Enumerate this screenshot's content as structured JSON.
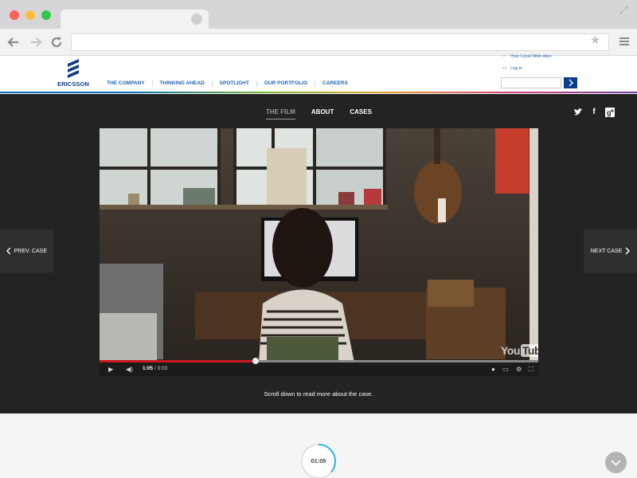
{
  "browser": {
    "address": "",
    "traffic_colors": {
      "close": "#fc605c",
      "minimize": "#fdbc40",
      "zoom": "#34c84a"
    }
  },
  "header": {
    "logo_text": "ERICSSON",
    "brand_color": "#0f3b8c",
    "nav": [
      "THE COMPANY",
      "THINKING AHEAD",
      "SPOTLIGHT",
      "OUR PORTFOLIO",
      "CAREERS"
    ],
    "local_sites_label": "Your Local Web sites",
    "login_label": "Log in",
    "search_placeholder": ""
  },
  "film": {
    "tabs": [
      {
        "label": "THE FILM",
        "active": true
      },
      {
        "label": "ABOUT",
        "active": false
      },
      {
        "label": "CASES",
        "active": false
      }
    ],
    "social": [
      "twitter-icon",
      "facebook-icon",
      "google-plus-icon"
    ],
    "prev_label": "PREV. CASE",
    "next_label": "NEXT CASE",
    "video": {
      "current_time": "1:05",
      "duration": "3:03",
      "progress_fraction": 0.355,
      "watermark": "You",
      "watermark_tube": "Tube"
    },
    "scroll_hint": "Scroll down to read more about the case."
  },
  "lower": {
    "timer": "01:05",
    "timer_progress_fraction": 0.36,
    "accent_color": "#29aee6"
  }
}
